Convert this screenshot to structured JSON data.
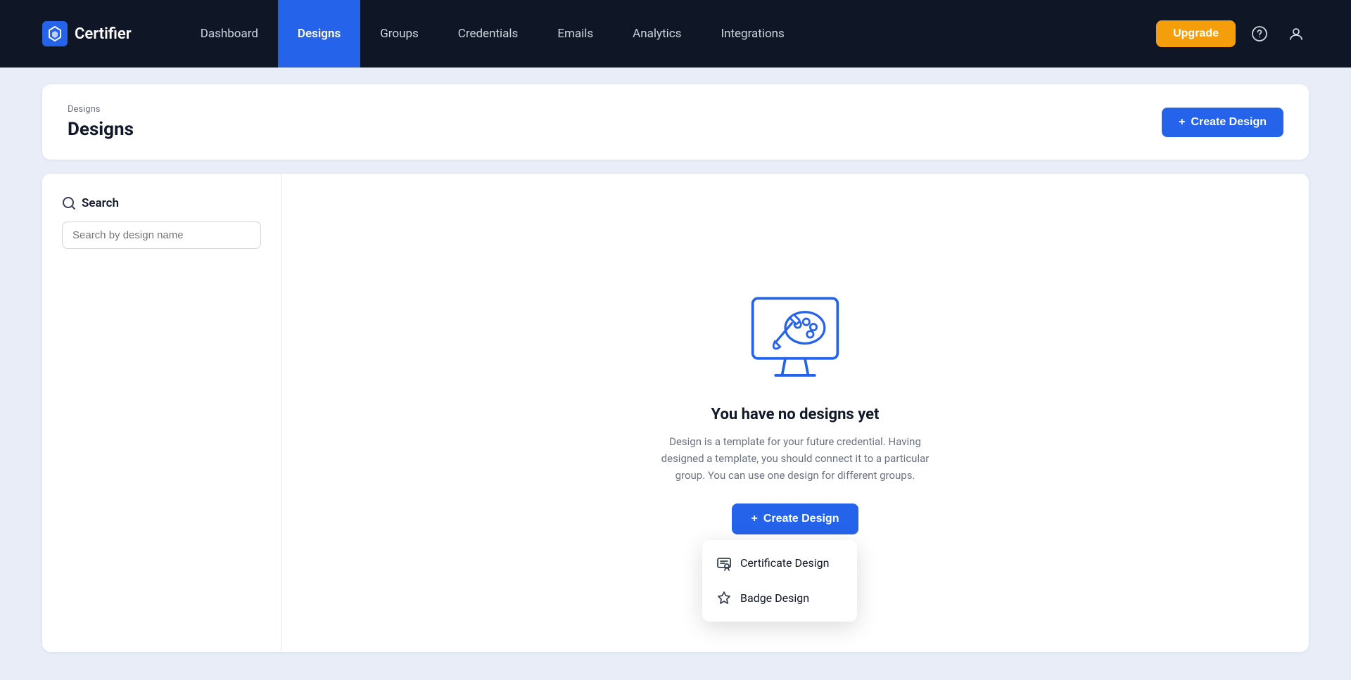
{
  "navbar": {
    "logo_text": "Certifier",
    "items": [
      {
        "label": "Dashboard",
        "active": false,
        "id": "dashboard"
      },
      {
        "label": "Designs",
        "active": true,
        "id": "designs"
      },
      {
        "label": "Groups",
        "active": false,
        "id": "groups"
      },
      {
        "label": "Credentials",
        "active": false,
        "id": "credentials"
      },
      {
        "label": "Emails",
        "active": false,
        "id": "emails"
      },
      {
        "label": "Analytics",
        "active": false,
        "id": "analytics"
      },
      {
        "label": "Integrations",
        "active": false,
        "id": "integrations"
      }
    ],
    "upgrade_label": "Upgrade"
  },
  "page_header": {
    "breadcrumb": "Designs",
    "title": "Designs",
    "create_btn_label": "Create Design"
  },
  "sidebar": {
    "search_label": "Search",
    "search_placeholder": "Search by design name"
  },
  "empty_state": {
    "title": "You have no designs yet",
    "description": "Design is a template for your future credential. Having designed a template, you should connect it to a particular group. You can use one design for different groups.",
    "create_btn_label": "Create Design"
  },
  "dropdown": {
    "items": [
      {
        "label": "Certificate Design",
        "icon": "certificate-icon",
        "id": "certificate"
      },
      {
        "label": "Badge Design",
        "icon": "badge-icon",
        "id": "badge"
      }
    ]
  },
  "colors": {
    "accent": "#2563eb",
    "upgrade": "#f59e0b"
  }
}
